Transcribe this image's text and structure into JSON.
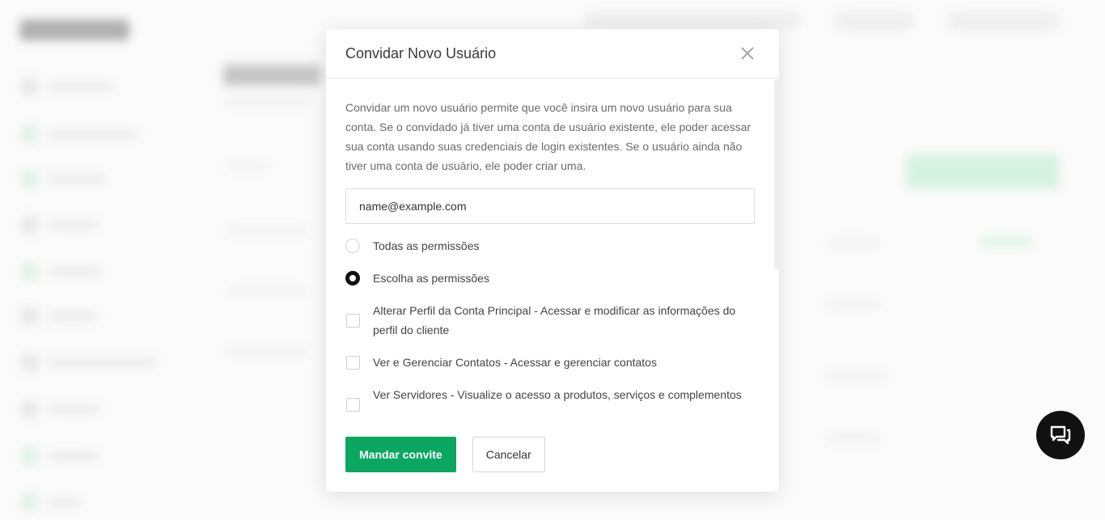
{
  "modal": {
    "title": "Convidar Novo Usuário",
    "description": "Convidar um novo usuário permite que você insira um novo usuário para sua conta. Se o convidado já tiver uma conta de usuário existente, ele poder acessar sua conta usando suas credenciais de login existentes. Se o usuário ainda não tiver uma conta de usuário, ele poder criar uma.",
    "email_value": "",
    "email_placeholder": "name@example.com",
    "permission_mode": {
      "all_label": "Todas as permissões",
      "choose_label": "Escolha as permissões",
      "selected": "choose"
    },
    "permissions": [
      {
        "label": "Alterar Perfil da Conta Principal - Acessar e modificar as informações do perfil do cliente",
        "checked": false
      },
      {
        "label": "Ver e Gerenciar Contatos - Acessar e gerenciar contatos",
        "checked": false
      },
      {
        "label": "Ver Servidores - Visualize o acesso a produtos, serviços e complementos",
        "checked": false
      }
    ],
    "submit_label": "Mandar convite",
    "cancel_label": "Cancelar"
  },
  "icons": {
    "close": "close-icon",
    "chat": "chat-icon"
  },
  "colors": {
    "primary": "#0aa760",
    "chat_fab": "#111111"
  }
}
